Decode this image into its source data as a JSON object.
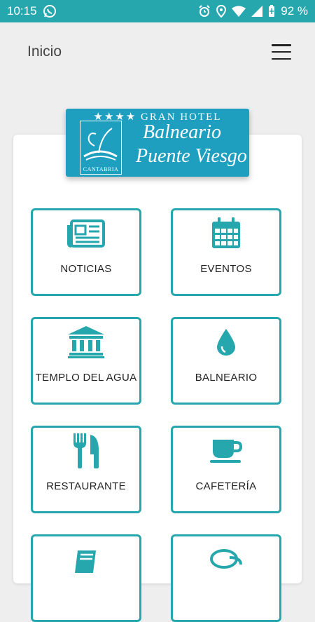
{
  "status_bar": {
    "time": "10:15",
    "battery": "92 %"
  },
  "app_bar": {
    "title": "Inicio",
    "menu_icon": "hamburger-menu-icon"
  },
  "logo": {
    "top_line": "★★★★ GRAN HOTEL",
    "line1": "Balneario",
    "line2": "Puente Viesgo",
    "region": "CANTABRIA"
  },
  "colors": {
    "accent": "#26a6ad",
    "logo_bg": "#1e9fc0"
  },
  "tiles": [
    {
      "label": "NOTICIAS",
      "icon": "newspaper-icon"
    },
    {
      "label": "EVENTOS",
      "icon": "calendar-icon"
    },
    {
      "label": "TEMPLO DEL AGUA",
      "icon": "temple-icon"
    },
    {
      "label": "BALNEARIO",
      "icon": "water-drop-icon"
    },
    {
      "label": "RESTAURANTE",
      "icon": "cutlery-icon"
    },
    {
      "label": "CAFETERÍA",
      "icon": "coffee-cup-icon"
    },
    {
      "label": "",
      "icon": "book-icon"
    },
    {
      "label": "",
      "icon": "chat-icon"
    }
  ]
}
